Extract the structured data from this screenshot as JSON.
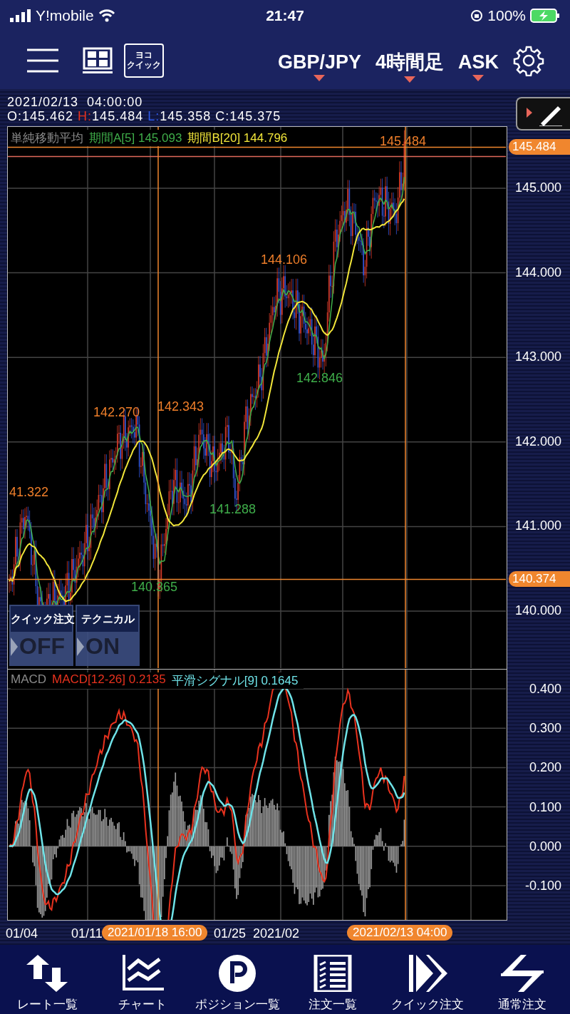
{
  "status_bar": {
    "carrier": "Y!mobile",
    "time": "21:47",
    "battery": "100%"
  },
  "header": {
    "quick_icon_lines": [
      "ヨコ",
      "クイック"
    ],
    "selectors": [
      "GBP/JPY",
      "4時間足",
      "ASK"
    ]
  },
  "info": {
    "datetime": "2021/02/13  04:00:00",
    "ohlc": [
      {
        "label": "O:",
        "value": "145.462",
        "color": "#ffffff"
      },
      {
        "label": "H:",
        "value": "145.484",
        "color": "#e8321e"
      },
      {
        "label": "L:",
        "value": "145.358",
        "color": "#2f5bea"
      },
      {
        "label": "C:",
        "value": "145.375",
        "color": "#ffffff"
      }
    ]
  },
  "price_chart": {
    "legend": [
      {
        "text": "単純移動平均",
        "color": "#8a8a8a"
      },
      {
        "text": "期間A[5] 145.093",
        "color": "#3fae4a"
      },
      {
        "text": "期間B[20] 144.796",
        "color": "#f2e63a"
      }
    ],
    "peak_labels": [
      {
        "text": "145.484",
        "color": "#f07f2a"
      },
      {
        "text": "144.106",
        "color": "#f07f2a"
      },
      {
        "text": "142.846",
        "color": "#3fae4a"
      },
      {
        "text": "142.270",
        "color": "#f07f2a"
      },
      {
        "text": "142.343",
        "color": "#f07f2a"
      },
      {
        "text": "141.288",
        "color": "#3fae4a"
      },
      {
        "text": "41.322",
        "color": "#f07f2a"
      },
      {
        "text": "140.365",
        "color": "#3fae4a"
      }
    ],
    "y_ticks": [
      "145.000",
      "144.000",
      "143.000",
      "142.000",
      "141.000",
      "140.000"
    ],
    "badges": [
      "145.484",
      "140.374"
    ],
    "toggles": [
      {
        "title": "クイック注文",
        "state": "OFF"
      },
      {
        "title": "テクニカル",
        "state": "ON"
      }
    ]
  },
  "macd_chart": {
    "legend": [
      {
        "text": "MACD",
        "color": "#8a8a8a"
      },
      {
        "text": "MACD[12-26] 0.2135",
        "color": "#e8321e"
      },
      {
        "text": "平滑シグナル[9] 0.1645",
        "color": "#6fe3e8"
      }
    ],
    "y_ticks": [
      "0.400",
      "0.300",
      "0.200",
      "0.100",
      "0.000",
      "-0.100"
    ]
  },
  "x_axis": {
    "labels": [
      "01/04",
      "01/11",
      "01/25",
      "2021/02"
    ],
    "cursor_badges": [
      "2021/01/18 16:00",
      "2021/02/13 04:00"
    ]
  },
  "bottom_nav": [
    "レート一覧",
    "チャート",
    "ポジション一覧",
    "注文一覧",
    "クイック注文",
    "通常注文"
  ]
}
